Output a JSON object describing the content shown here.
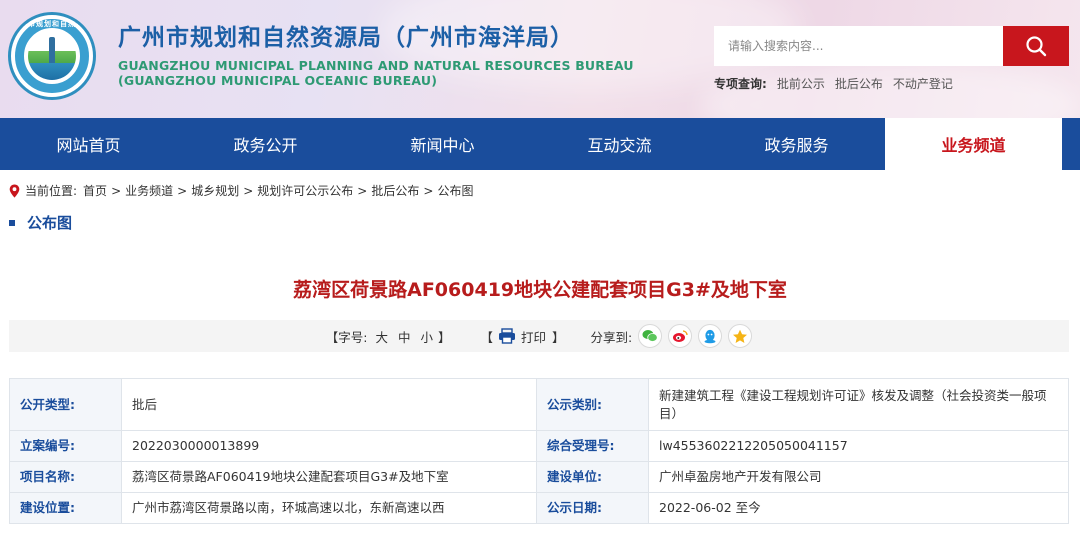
{
  "header": {
    "title_cn": "广州市规划和自然资源局（广州市海洋局）",
    "title_en_1": "GUANGZHOU MUNICIPAL PLANNING AND NATURAL RESOURCES BUREAU",
    "title_en_2": "(GUANGZHOU MUNICIPAL OCEANIC BUREAU)",
    "logo_text": "广州市规划和自然资源",
    "search": {
      "placeholder": "请输入搜索内容..."
    },
    "special_query": {
      "label": "专项查询:",
      "links": [
        "批前公示",
        "批后公布",
        "不动产登记"
      ]
    }
  },
  "nav": {
    "items": [
      "网站首页",
      "政务公开",
      "新闻中心",
      "互动交流",
      "政务服务",
      "业务频道"
    ],
    "active_index": 5
  },
  "breadcrumb": {
    "prefix": "当前位置:",
    "items": [
      "首页",
      "业务频道",
      "城乡规划",
      "规划许可公示公布",
      "批后公布",
      "公布图"
    ],
    "separator": ">"
  },
  "section": {
    "title": "公布图"
  },
  "article": {
    "title": "荔湾区荷景路AF060419地块公建配套项目G3#及地下室"
  },
  "toolbar": {
    "font_label": "【字号:",
    "sizes": [
      "大",
      "中",
      "小"
    ],
    "font_close": "】",
    "print_open": "【",
    "print_label": "打印",
    "print_close": "】",
    "share_label": "分享到:",
    "share_icons": [
      "wechat-icon",
      "weibo-icon",
      "qq-icon",
      "qzone-icon"
    ]
  },
  "info": {
    "rows": [
      [
        "公开类型:",
        "批后",
        "公示类别:",
        "新建建筑工程《建设工程规划许可证》核发及调整（社会投资类一般项目）"
      ],
      [
        "立案编号:",
        "2022030000013899",
        "综合受理号:",
        "lw455360221220505004115​7"
      ],
      [
        "项目名称:",
        "荔湾区荷景路AF060419地块公建配套项目G3#及地下室",
        "建设单位:",
        "广州卓盈房地产开发有限公司"
      ],
      [
        "建设位置:",
        "广州市荔湾区荷景路以南，环城高速以北，东新高速以西",
        "公示日期:",
        "2022-06-02 至今"
      ]
    ]
  },
  "colors": {
    "brand_blue": "#1a4d9c",
    "accent_red": "#c8161d",
    "title_red": "#b71c1c",
    "english_green": "#2e9a74"
  }
}
